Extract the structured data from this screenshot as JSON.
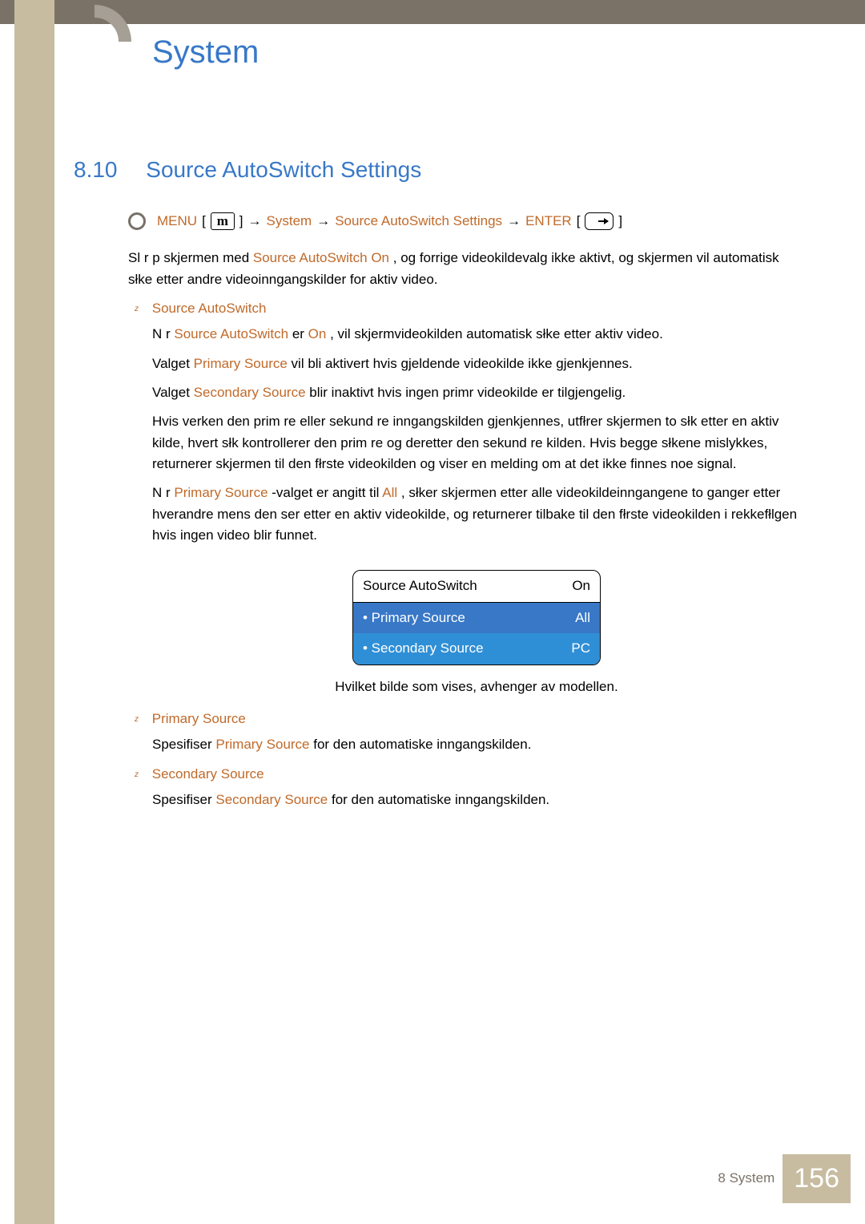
{
  "header": {
    "chapter_title": "System"
  },
  "section": {
    "number": "8.10",
    "title": "Source AutoSwitch Settings"
  },
  "nav": {
    "menu_label": "MENU",
    "menu_icon_glyph": "m",
    "arrow": "→",
    "item1": "System",
    "item2": "Source AutoSwitch Settings",
    "enter_label": "ENTER"
  },
  "intro": {
    "pre": "Sl r p  skjermen med ",
    "hl": "Source AutoSwitch",
    "on_hl": "On",
    "post": ", og forrige videokildevalg ikke aktivt, og skjermen vil automatisk słke etter andre videoinngangskilder for aktiv video."
  },
  "sec_sas": {
    "title": "Source AutoSwitch",
    "p1_a": "N r ",
    "p1_hl": "Source AutoSwitch",
    "p1_b": "  er ",
    "p1_on": "On",
    "p1_c": ", vil skjermvideokilden automatisk słke etter aktiv video.",
    "p2_a": "Valget ",
    "p2_hl": "Primary Source",
    "p2_b": " vil bli aktivert hvis gjeldende videokilde ikke gjenkjennes.",
    "p3_a": "Valget ",
    "p3_hl": "Secondary Source",
    "p3_b": " blir inaktivt hvis ingen primr videokilde er tilgjengelig.",
    "p4": "Hvis verken den prim re eller sekund re inngangskilden gjenkjennes, utfłrer skjermen to słk etter en aktiv kilde, hvert słk kontrollerer den prim re og deretter den sekund re kilden. Hvis begge słkene mislykkes, returnerer skjermen til den fłrste videokilden og viser en melding om at det ikke finnes noe signal.",
    "p5_a": "N r ",
    "p5_hl": "Primary Source",
    "p5_b": " -valget er angitt til ",
    "p5_all": "All",
    "p5_c": ", słker skjermen etter alle videokildeinngangene to ganger etter hverandre mens den ser etter en aktiv videokilde, og returnerer tilbake til den fłrste videokilden i rekkefłlgen hvis ingen video blir funnet."
  },
  "osd": {
    "row1_label": "Source AutoSwitch",
    "row1_val": "On",
    "row2_label": "• Primary Source",
    "row2_val": "All",
    "row3_label": "• Secondary Source",
    "row3_val": "PC"
  },
  "osd_caption": "Hvilket bilde som vises, avhenger av modellen.",
  "sec_ps": {
    "title": "Primary Source",
    "p_a": "Spesifiser ",
    "p_hl": "Primary Source",
    "p_b": "  for den automatiske inngangskilden."
  },
  "sec_ss": {
    "title": "Secondary Source",
    "p_a": "Spesifiser ",
    "p_hl": "Secondary Source",
    "p_b": " for den automatiske inngangskilden."
  },
  "footer": {
    "chapter": "8 System",
    "page": "156"
  }
}
